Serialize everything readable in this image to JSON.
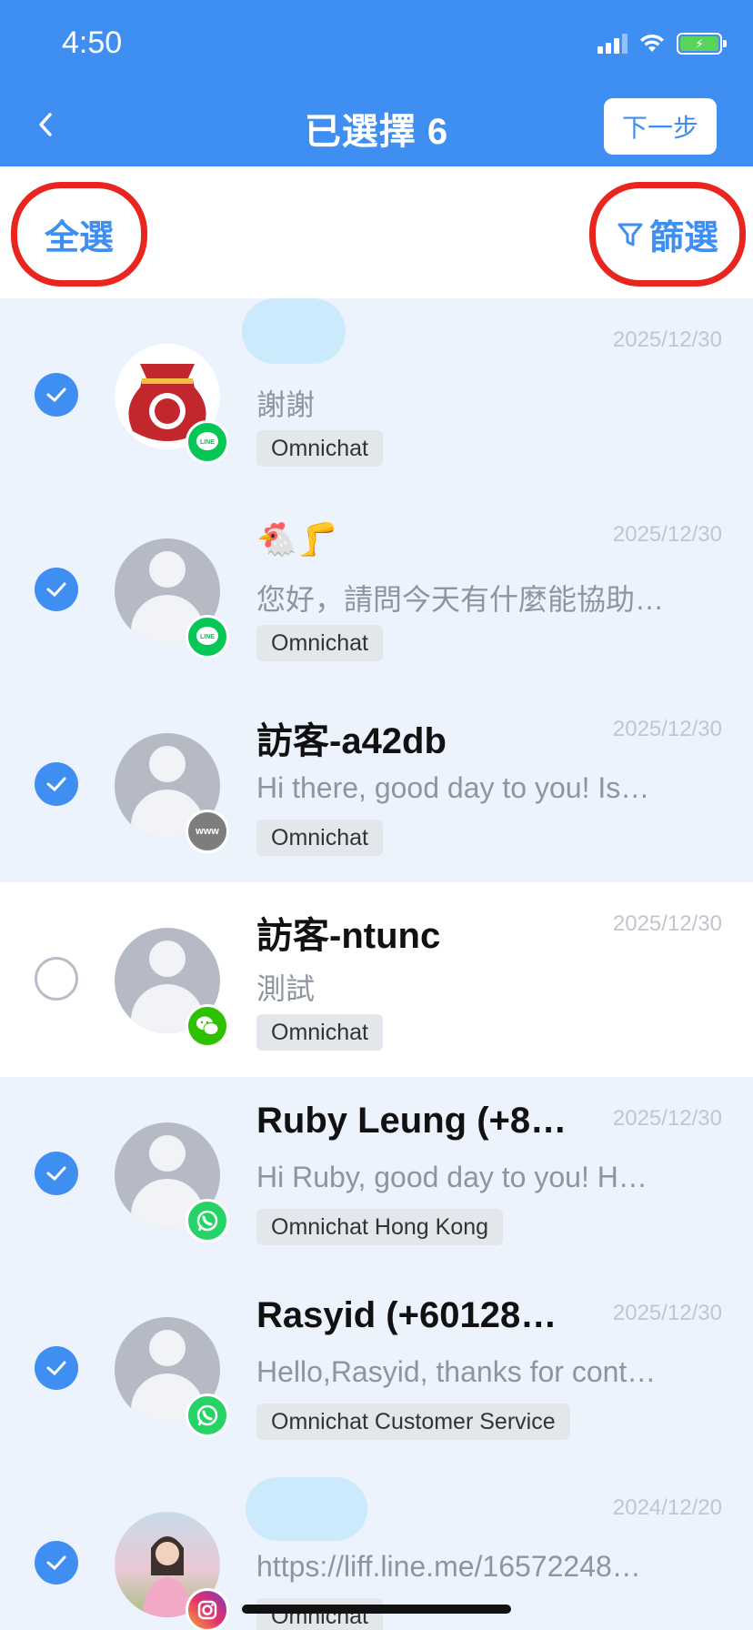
{
  "status_bar": {
    "time": "4:50"
  },
  "header": {
    "title": "已選擇 6",
    "next_label": "下一步"
  },
  "toolbar": {
    "select_all_label": "全選",
    "filter_label": "篩選"
  },
  "conversations": [
    {
      "name": "",
      "date": "2025/12/30",
      "message": "謝謝",
      "tag": "Omnichat",
      "selected": true,
      "channel": "line-icon"
    },
    {
      "name": "🐔🦵",
      "date": "2025/12/30",
      "message": "您好，請問今天有什麼能協助…",
      "tag": "Omnichat",
      "selected": true,
      "channel": "line-icon"
    },
    {
      "name": "訪客-a42db",
      "date": "2025/12/30",
      "message": "Hi there, good day to you! Is…",
      "tag": "Omnichat",
      "selected": true,
      "channel": "web-icon",
      "channel_text": "www"
    },
    {
      "name": "訪客-ntunc",
      "date": "2025/12/30",
      "message": "測試",
      "tag": "Omnichat",
      "selected": false,
      "channel": "wechat-icon"
    },
    {
      "name": "Ruby Leung (+8…",
      "date": "2025/12/30",
      "message": "Hi Ruby, good day to you! H…",
      "tag": "Omnichat Hong Kong",
      "selected": true,
      "channel": "whatsapp-icon"
    },
    {
      "name": "Rasyid (+60128…",
      "date": "2025/12/30",
      "message": "Hello,Rasyid, thanks for cont…",
      "tag": "Omnichat Customer Service",
      "selected": true,
      "channel": "whatsapp-icon"
    },
    {
      "name": "",
      "date": "2024/12/20",
      "message": "https://liff.line.me/16572248…",
      "tag": "Omnichat",
      "selected": true,
      "channel": "instagram-icon"
    }
  ],
  "colors": {
    "primary": "#3f8ef2",
    "highlight": "#e8251f",
    "selected_row": "#edf3fd"
  }
}
